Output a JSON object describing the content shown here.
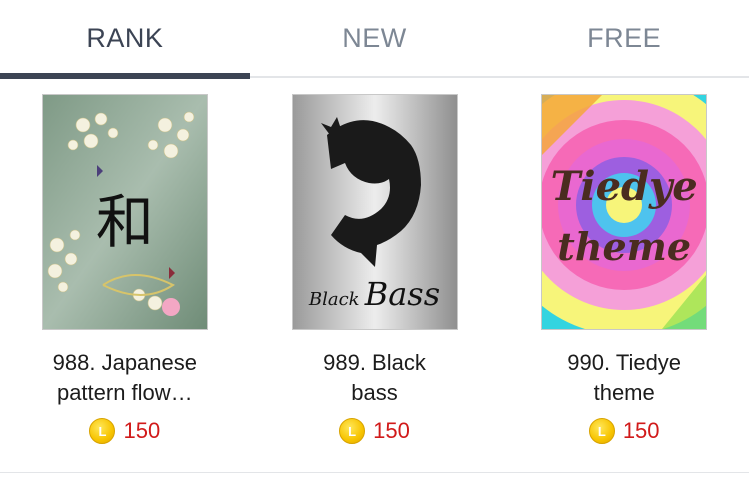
{
  "tabs": [
    {
      "label": "RANK",
      "active": true
    },
    {
      "label": "NEW",
      "active": false
    },
    {
      "label": "FREE",
      "active": false
    }
  ],
  "themes": [
    {
      "title_line1": "988. Japanese",
      "title_line2": "pattern flow…",
      "price": "150",
      "thumb_text": "和",
      "thumb_icon": "japanese-flower-icon"
    },
    {
      "title_line1": "989. Black",
      "title_line2": "bass",
      "price": "150",
      "thumb_text_a": "Black",
      "thumb_text_b": "Bass",
      "thumb_icon": "bass-fish-icon"
    },
    {
      "title_line1": "990. Tiedye",
      "title_line2": "theme",
      "price": "150",
      "thumb_text_a": "Tiedye",
      "thumb_text_b": "theme",
      "thumb_icon": "tiedye-swirl-icon"
    }
  ],
  "coin_symbol": "L",
  "colors": {
    "accent": "#3c4454",
    "price": "#d11a1a",
    "coin": "#f7c400"
  }
}
